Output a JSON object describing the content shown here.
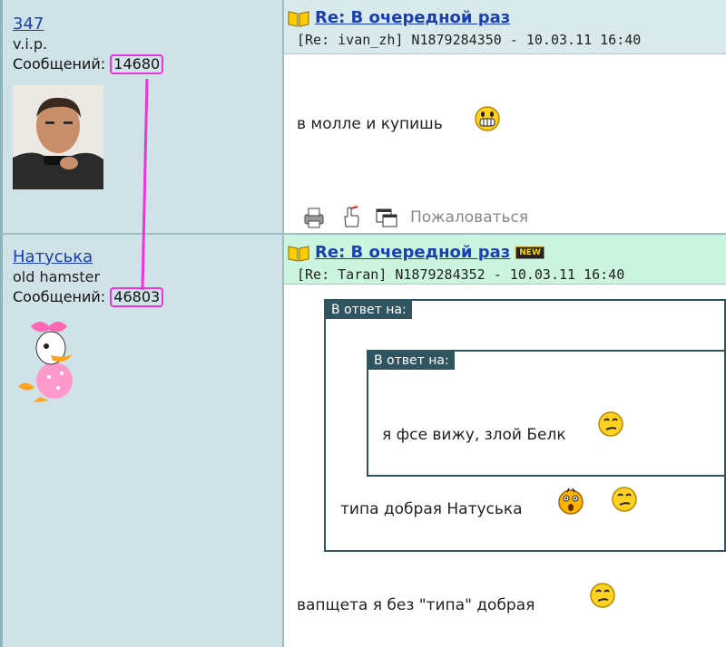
{
  "posts": [
    {
      "author": {
        "name": "347",
        "status": "v.i.p.",
        "messages_label": "Сообщений:",
        "messages_count": "14680"
      },
      "title": "Re: В очередной раз",
      "meta": "[Re: ivan_zh] N1879284350 - 10.03.11 16:40",
      "body": "в молле и купишь",
      "actions": {
        "report": "Пожаловаться"
      }
    },
    {
      "author": {
        "name": "Натуська",
        "status": "old hamster",
        "messages_label": "Сообщений:",
        "messages_count": "46803"
      },
      "title": "Re: В очередной раз",
      "new_badge": "NEW",
      "meta": "[Re: Taran] N1879284352 - 10.03.11 16:40",
      "quote_outer": {
        "label": "В ответ на:",
        "text": "типа добрая Натуська"
      },
      "quote_inner": {
        "label": "В ответ на:",
        "text": "я фсе вижу, злой Белк"
      },
      "body": "вапщета я без \"типа\" добрая"
    }
  ],
  "colors": {
    "left_bg": "#cfe2e7",
    "header_bg": "#d9eaec",
    "new_header_bg": "#ccf5e0",
    "link": "#1a3fb0",
    "annotation": "#ee33dd",
    "quote_border": "#315560"
  },
  "icons": [
    "book-icon",
    "printer-icon",
    "hand-point-icon",
    "window-link-icon",
    "grin-smiley-icon",
    "wink-smiley-icon",
    "surprised-smiley-icon"
  ]
}
